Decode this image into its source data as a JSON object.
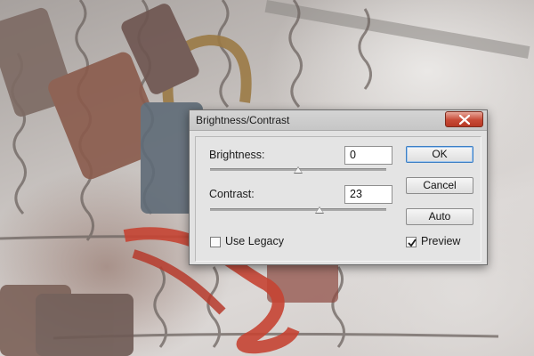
{
  "dialog": {
    "title": "Brightness/Contrast",
    "close_icon": "close-icon"
  },
  "brightness": {
    "label": "Brightness:",
    "value": "0",
    "slider_fraction": 0.5
  },
  "contrast": {
    "label": "Contrast:",
    "value": "23",
    "slider_fraction": 0.62
  },
  "buttons": {
    "ok": "OK",
    "cancel": "Cancel",
    "auto": "Auto"
  },
  "options": {
    "use_legacy": {
      "label": "Use Legacy",
      "checked": false
    },
    "preview": {
      "label": "Preview",
      "checked": true
    }
  },
  "colors": {
    "accent": "#3d7fc4",
    "close": "#c74a36"
  }
}
